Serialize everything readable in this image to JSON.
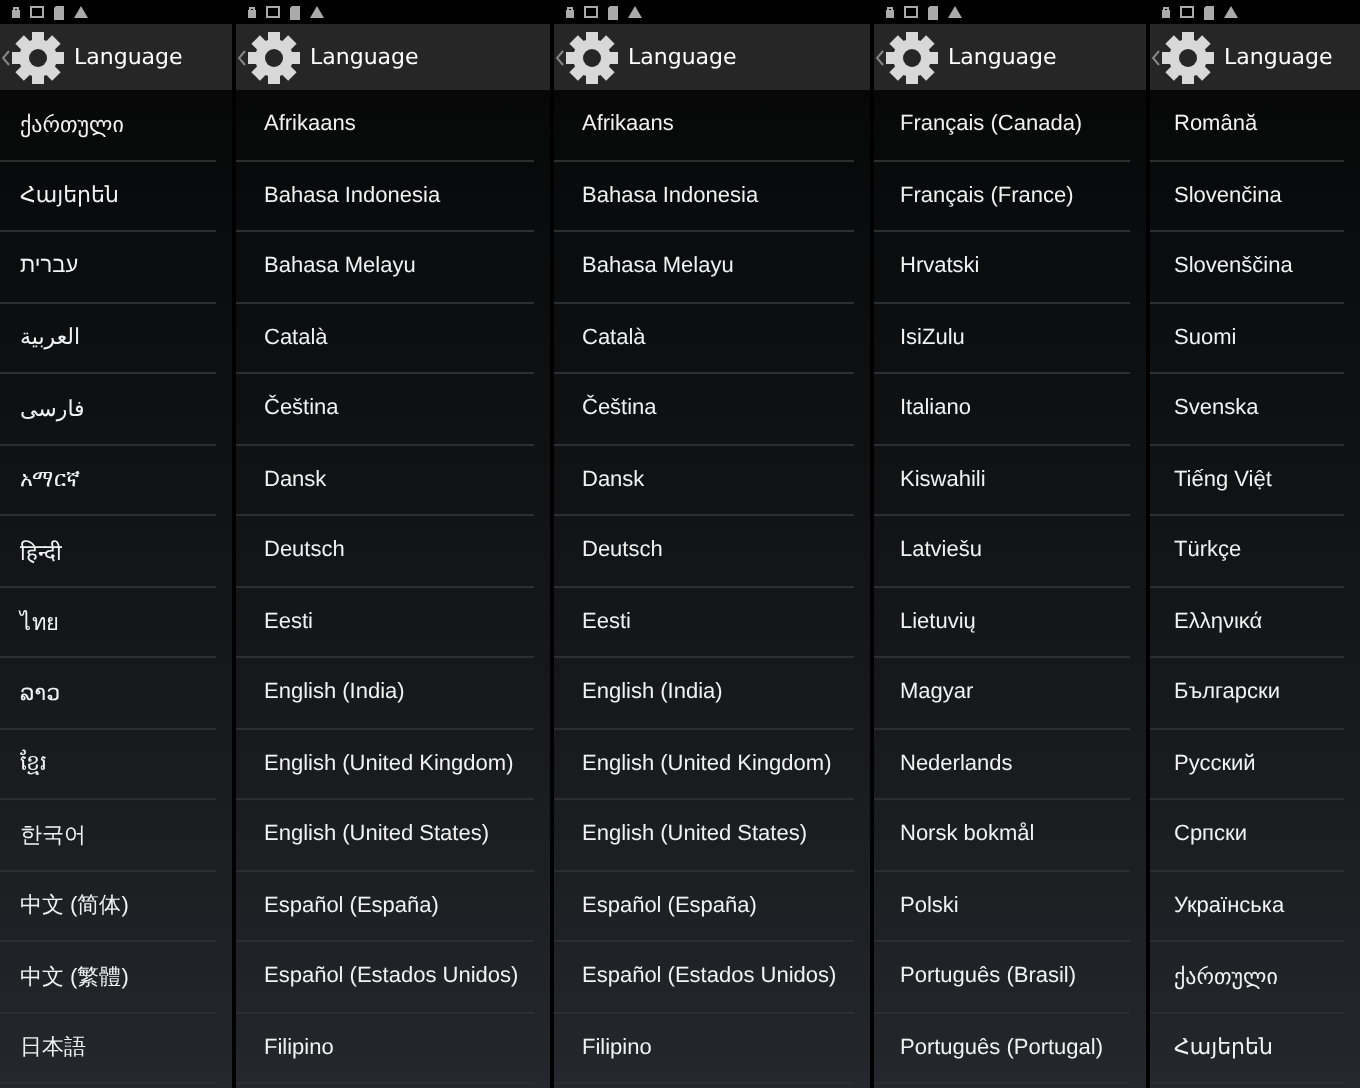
{
  "screens": [
    {
      "title": "Language",
      "items": [
        "ქართული",
        "Հայերեն",
        "עברית",
        "العربية",
        "فارسی",
        "አማርኛ",
        "हिन्दी",
        "ไทย",
        "ລາວ",
        "ខ្មែរ",
        "한국어",
        "中文 (简体)",
        "中文 (繁體)",
        "日本語"
      ]
    },
    {
      "title": "Language",
      "items": [
        "Afrikaans",
        "Bahasa Indonesia",
        "Bahasa Melayu",
        "Català",
        "Čeština",
        "Dansk",
        "Deutsch",
        "Eesti",
        "English (India)",
        "English (United Kingdom)",
        "English (United States)",
        "Español (España)",
        "Español (Estados Unidos)",
        "Filipino"
      ]
    },
    {
      "title": "Language",
      "items": [
        "Afrikaans",
        "Bahasa Indonesia",
        "Bahasa Melayu",
        "Català",
        "Čeština",
        "Dansk",
        "Deutsch",
        "Eesti",
        "English (India)",
        "English (United Kingdom)",
        "English (United States)",
        "Español (España)",
        "Español (Estados Unidos)",
        "Filipino"
      ]
    },
    {
      "title": "Language",
      "items": [
        "Français (Canada)",
        "Français (France)",
        "Hrvatski",
        "IsiZulu",
        "Italiano",
        "Kiswahili",
        "Latviešu",
        "Lietuvių",
        "Magyar",
        "Nederlands",
        "Norsk bokmål",
        "Polski",
        "Português (Brasil)",
        "Português (Portugal)"
      ]
    },
    {
      "title": "Language",
      "items": [
        "Română",
        "Slovenčina",
        "Slovenščina",
        "Suomi",
        "Svenska",
        "Tiếng Việt",
        "Türkçe",
        "Ελληνικά",
        "Български",
        "Русский",
        "Српски",
        "Українська",
        "ქართული",
        "Հայերեն"
      ]
    }
  ]
}
